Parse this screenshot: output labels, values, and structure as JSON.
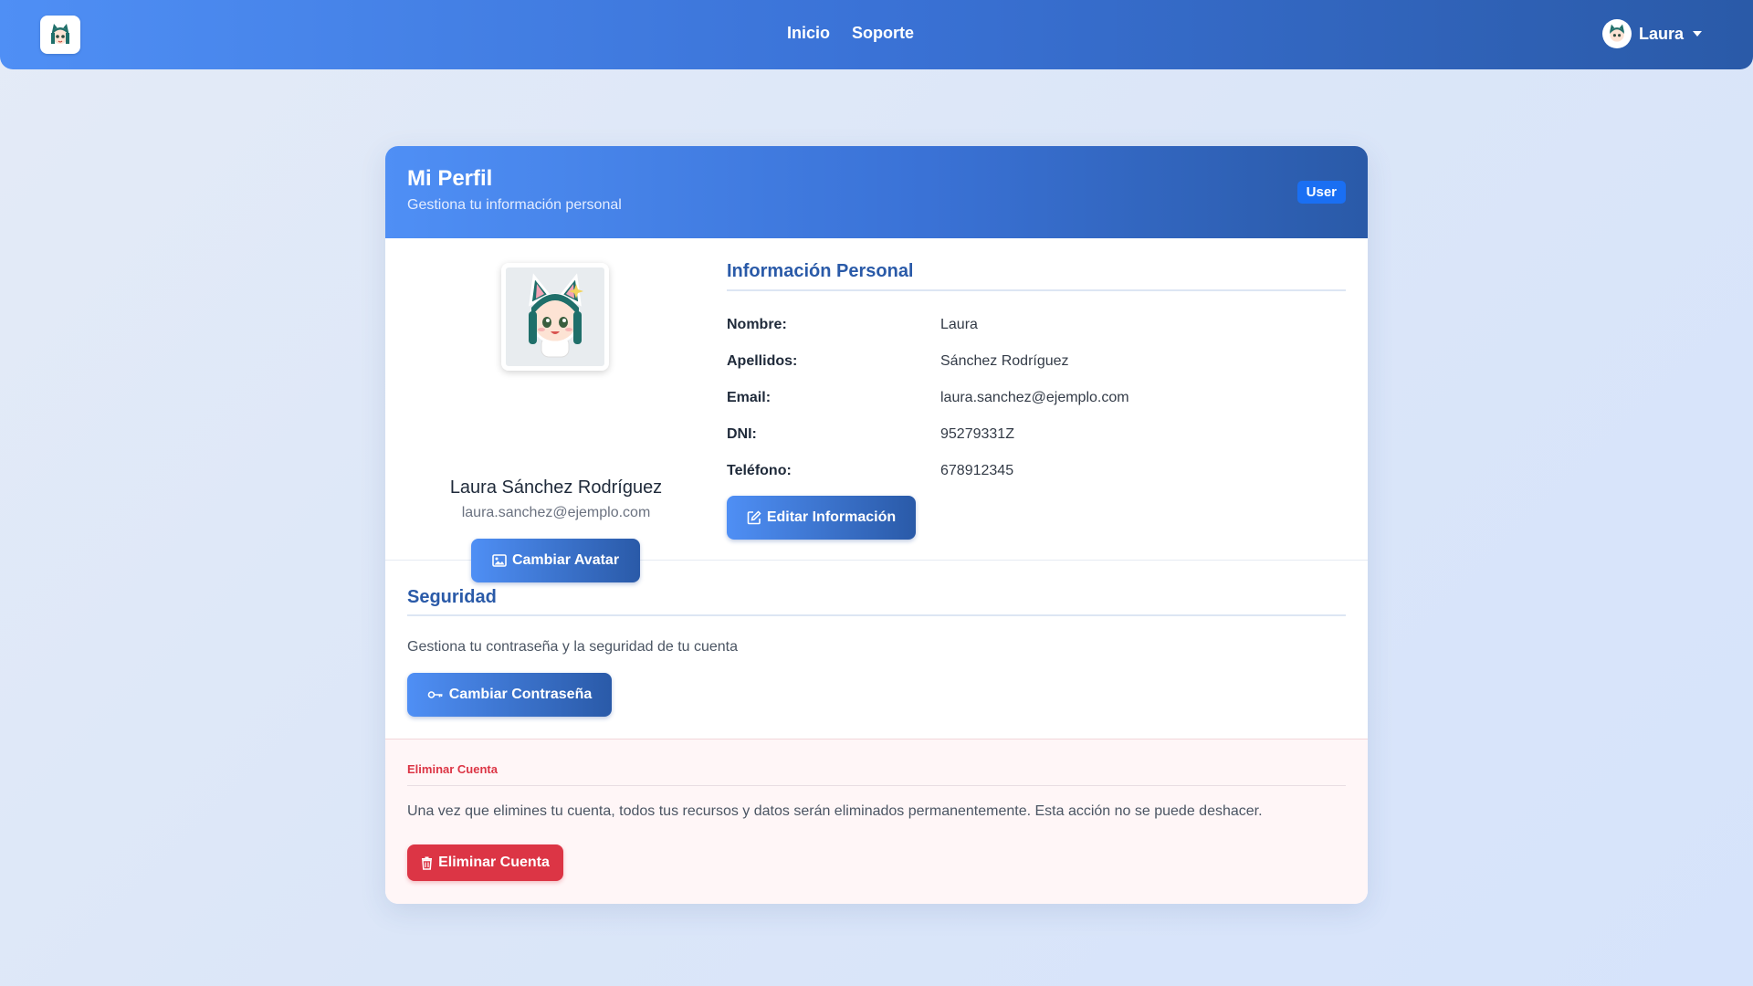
{
  "navbar": {
    "links": [
      "Inicio",
      "Soporte"
    ],
    "user_name": "Laura",
    "logo_icon": "cat-girl-avatar-icon"
  },
  "card": {
    "title": "Mi Perfil",
    "subtitle": "Gestiona tu información personal",
    "role_badge": "User"
  },
  "profile": {
    "full_name": "Laura Sánchez Rodríguez",
    "email": "laura.sanchez@ejemplo.com",
    "change_avatar_label": "Cambiar Avatar"
  },
  "personal_info": {
    "title": "Información Personal",
    "rows": [
      {
        "label": "Nombre:",
        "value": "Laura"
      },
      {
        "label": "Apellidos:",
        "value": "Sánchez Rodríguez"
      },
      {
        "label": "Email:",
        "value": "laura.sanchez@ejemplo.com"
      },
      {
        "label": "DNI:",
        "value": "95279331Z"
      },
      {
        "label": "Teléfono:",
        "value": "678912345"
      }
    ],
    "edit_label": "Editar Información"
  },
  "security": {
    "title": "Seguridad",
    "description": "Gestiona tu contraseña y la seguridad de tu cuenta",
    "change_password_label": "Cambiar Contraseña"
  },
  "danger": {
    "title": "Eliminar Cuenta",
    "description": "Una vez que elimines tu cuenta, todos tus recursos y datos serán eliminados permanentemente. Esta acción no se puede deshacer.",
    "delete_label": "Eliminar Cuenta"
  },
  "colors": {
    "primary": "#4f8ff5",
    "primary_dark": "#2a5aa8",
    "badge": "#1a6ff3",
    "danger": "#dc3545"
  }
}
